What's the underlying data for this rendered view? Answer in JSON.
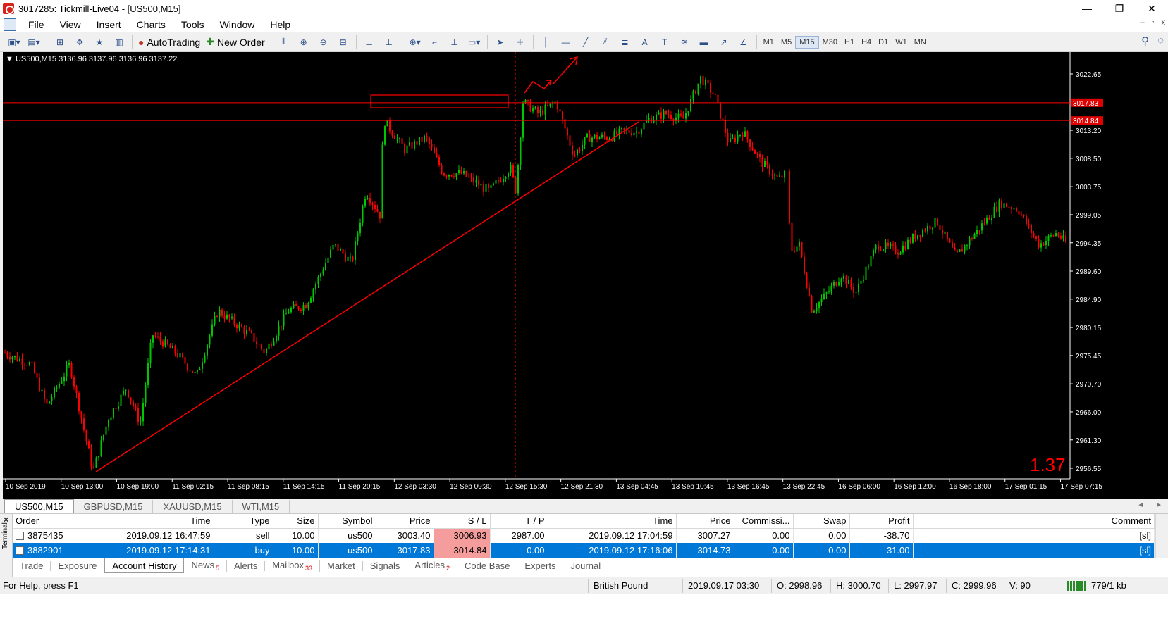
{
  "window": {
    "title": "3017285: Tickmill-Live04 - [US500,M15]",
    "controls": [
      "—",
      "❐",
      "✕"
    ]
  },
  "menu": {
    "items": [
      "File",
      "View",
      "Insert",
      "Charts",
      "Tools",
      "Window",
      "Help"
    ],
    "mdi_controls": [
      "–",
      "▫",
      "x"
    ]
  },
  "toolbar": {
    "autotrading_label": "AutoTrading",
    "new_order_label": "New Order",
    "timeframes": [
      "M1",
      "M5",
      "M15",
      "M30",
      "H1",
      "H4",
      "D1",
      "W1",
      "MN"
    ],
    "active_timeframe": "M15"
  },
  "chart": {
    "info": "▼ US500,M15  3136.96 3137.96 3136.96 3137.22",
    "background": "#000000",
    "bull_color": "#00c800",
    "bear_color": "#ff0000",
    "overlay_value": "1.37",
    "price_ticks": [
      "3022.65",
      "3013.20",
      "3008.50",
      "3003.75",
      "2999.05",
      "2994.35",
      "2989.60",
      "2984.90",
      "2980.15",
      "2975.45",
      "2970.70",
      "2966.00",
      "2961.30",
      "2956.55"
    ],
    "price_tick_values": [
      3022.65,
      3013.2,
      3008.5,
      3003.75,
      2999.05,
      2994.35,
      2989.6,
      2984.9,
      2980.15,
      2975.45,
      2970.7,
      2966.0,
      2961.3,
      2956.55
    ],
    "horizontal_lines": [
      {
        "label": "3017.83",
        "value": 3017.83
      },
      {
        "label": "3014.84",
        "value": 3014.84
      }
    ],
    "time_ticks": [
      "10 Sep 2019",
      "10 Sep 13:00",
      "10 Sep 19:00",
      "11 Sep 02:15",
      "11 Sep 08:15",
      "11 Sep 14:15",
      "11 Sep 20:15",
      "12 Sep 03:30",
      "12 Sep 09:30",
      "12 Sep 15:30",
      "12 Sep 21:30",
      "13 Sep 04:45",
      "13 Sep 10:45",
      "13 Sep 16:45",
      "13 Sep 22:45",
      "16 Sep 06:00",
      "16 Sep 12:00",
      "16 Sep 18:00",
      "17 Sep 01:15",
      "17 Sep 07:15"
    ]
  },
  "symbol_tabs": [
    "US500,M15",
    "GBPUSD,M15",
    "XAUUSD,M15",
    "WTI,M15"
  ],
  "symbol_tab_arrows": [
    "◄",
    "►"
  ],
  "terminal": {
    "side_label": "Terminal",
    "columns": [
      "Order",
      "Time",
      "Type",
      "Size",
      "Symbol",
      "Price",
      "S / L",
      "T / P",
      "Time",
      "Price",
      "Commissi...",
      "Swap",
      "Profit",
      "Comment"
    ],
    "rows": [
      {
        "order": "3875435",
        "time": "2019.09.12 16:47:59",
        "type": "sell",
        "size": "10.00",
        "symbol": "us500",
        "price": "3003.40",
        "sl": "3006.93",
        "tp": "2987.00",
        "close_time": "2019.09.12 17:04:59",
        "close_price": "3007.27",
        "commission": "0.00",
        "swap": "0.00",
        "profit": "-38.70",
        "comment": "[sl]"
      },
      {
        "order": "3882901",
        "time": "2019.09.12 17:14:31",
        "type": "buy",
        "size": "10.00",
        "symbol": "us500",
        "price": "3017.83",
        "sl": "3014.84",
        "tp": "0.00",
        "close_time": "2019.09.12 17:16:06",
        "close_price": "3014.73",
        "commission": "0.00",
        "swap": "0.00",
        "profit": "-31.00",
        "comment": "[sl]"
      }
    ],
    "tabs": [
      {
        "label": "Trade",
        "badge": ""
      },
      {
        "label": "Exposure",
        "badge": ""
      },
      {
        "label": "Account History",
        "badge": ""
      },
      {
        "label": "News",
        "badge": "5"
      },
      {
        "label": "Alerts",
        "badge": ""
      },
      {
        "label": "Mailbox",
        "badge": "33"
      },
      {
        "label": "Market",
        "badge": ""
      },
      {
        "label": "Signals",
        "badge": ""
      },
      {
        "label": "Articles",
        "badge": "2"
      },
      {
        "label": "Code Base",
        "badge": ""
      },
      {
        "label": "Experts",
        "badge": ""
      },
      {
        "label": "Journal",
        "badge": ""
      }
    ],
    "active_tab": "Account History"
  },
  "status": {
    "help": "For Help, press F1",
    "profile": "British Pound",
    "datetime": "2019.09.17 03:30",
    "open": "O: 2998.96",
    "high": "H: 3000.70",
    "low": "L: 2997.97",
    "close": "C: 2999.96",
    "volume": "V: 90",
    "traffic": "779/1 kb"
  }
}
